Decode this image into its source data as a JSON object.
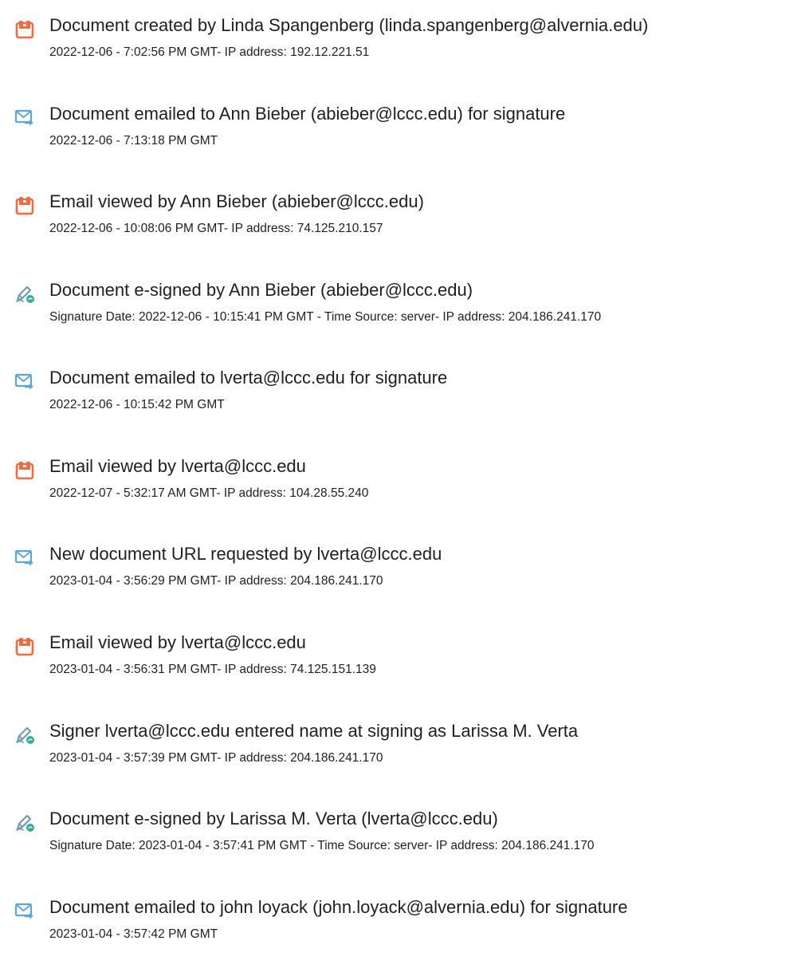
{
  "colors": {
    "doc_icon": "#f26a3d",
    "email_icon": "#5aa7e0",
    "sign_icon_pen": "#6f9ab5",
    "sign_icon_dot": "#2fae9a",
    "text": "#1f1f1f"
  },
  "events": [
    {
      "icon": "document-icon",
      "title": "Document created by Linda Spangenberg (linda.spangenberg@alvernia.edu)",
      "detail": "2022-12-06 - 7:02:56 PM GMT- IP address: 192.12.221.51"
    },
    {
      "icon": "email-sent-icon",
      "title": "Document emailed to Ann Bieber (abieber@lccc.edu) for signature",
      "detail": "2022-12-06 - 7:13:18 PM GMT"
    },
    {
      "icon": "document-icon",
      "title": "Email viewed by Ann Bieber (abieber@lccc.edu)",
      "detail": "2022-12-06 - 10:08:06 PM GMT- IP address: 74.125.210.157"
    },
    {
      "icon": "e-sign-pen-icon",
      "title": "Document e-signed by Ann Bieber (abieber@lccc.edu)",
      "detail": "Signature Date: 2022-12-06 - 10:15:41 PM GMT - Time Source: server- IP address: 204.186.241.170"
    },
    {
      "icon": "email-sent-icon",
      "title": "Document emailed to lverta@lccc.edu for signature",
      "detail": "2022-12-06 - 10:15:42 PM GMT"
    },
    {
      "icon": "document-icon",
      "title": "Email viewed by lverta@lccc.edu",
      "detail": "2022-12-07 - 5:32:17 AM GMT- IP address: 104.28.55.240"
    },
    {
      "icon": "email-sent-icon",
      "title": "New document URL requested by lverta@lccc.edu",
      "detail": "2023-01-04 - 3:56:29 PM GMT- IP address: 204.186.241.170"
    },
    {
      "icon": "document-icon",
      "title": "Email viewed by lverta@lccc.edu",
      "detail": "2023-01-04 - 3:56:31 PM GMT- IP address: 74.125.151.139"
    },
    {
      "icon": "e-sign-pen-icon",
      "title": "Signer lverta@lccc.edu entered name at signing as Larissa M. Verta",
      "detail": "2023-01-04 - 3:57:39 PM GMT- IP address: 204.186.241.170"
    },
    {
      "icon": "e-sign-pen-icon",
      "title": "Document e-signed by Larissa M. Verta (lverta@lccc.edu)",
      "detail": "Signature Date: 2023-01-04 - 3:57:41 PM GMT - Time Source: server- IP address: 204.186.241.170"
    },
    {
      "icon": "email-sent-icon",
      "title": "Document emailed to john loyack (john.loyack@alvernia.edu) for signature",
      "detail": "2023-01-04 - 3:57:42 PM GMT"
    }
  ]
}
